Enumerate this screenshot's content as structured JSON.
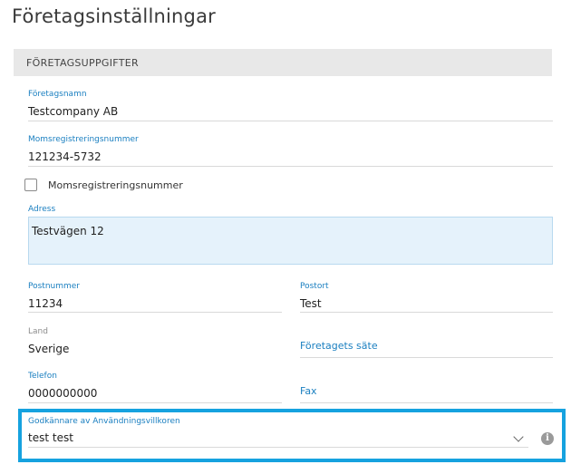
{
  "page": {
    "title": "Företagsinställningar"
  },
  "section": {
    "header": "FÖRETAGSUPPGIFTER"
  },
  "form": {
    "company_name": {
      "label": "Företagsnamn",
      "value": "Testcompany AB"
    },
    "vat_number": {
      "label": "Momsregistreringsnummer",
      "value": "121234-5732"
    },
    "vat_checkbox": {
      "label": "Momsregistreringsnummer",
      "checked": false
    },
    "address": {
      "label": "Adress",
      "value": "Testvägen 12"
    },
    "postal_code": {
      "label": "Postnummer",
      "value": "11234"
    },
    "city": {
      "label": "Postort",
      "value": "Test"
    },
    "country": {
      "label": "Land",
      "value": "Sverige"
    },
    "registered_office": {
      "label": "Företagets säte"
    },
    "phone": {
      "label": "Telefon",
      "value": "0000000000"
    },
    "fax": {
      "label": "Fax"
    },
    "terms_approver": {
      "label": "Godkännare av Användningsvillkoren",
      "value": "test test"
    }
  },
  "icons": {
    "info": "info-icon",
    "dropdown": "chevron-down-icon"
  },
  "colors": {
    "accent": "#1a7fc0",
    "highlight": "#16a2df",
    "section_bg": "#e8e8e8",
    "address_bg": "#e5f2fb"
  }
}
